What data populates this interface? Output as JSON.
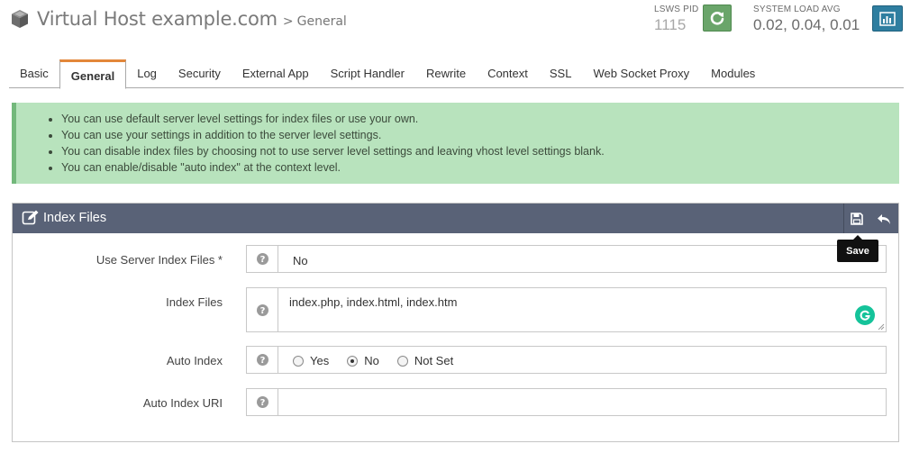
{
  "header": {
    "title": "Virtual Host example.com",
    "separator": ">",
    "subtitle": "General",
    "lsws_pid_label": "LSWS PID",
    "lsws_pid_value": "1115",
    "system_load_label": "SYSTEM LOAD AVG",
    "system_load_value": "0.02, 0.04, 0.01",
    "restart_icon": "refresh-icon",
    "stats_icon": "bar-chart-icon",
    "restart_color": "#6aa56a",
    "stats_color": "#2e7ea0"
  },
  "tabs": [
    {
      "label": "Basic"
    },
    {
      "label": "General"
    },
    {
      "label": "Log"
    },
    {
      "label": "Security"
    },
    {
      "label": "External App"
    },
    {
      "label": "Script Handler"
    },
    {
      "label": "Rewrite"
    },
    {
      "label": "Context"
    },
    {
      "label": "SSL"
    },
    {
      "label": "Web Socket Proxy"
    },
    {
      "label": "Modules"
    }
  ],
  "active_tab": "General",
  "alert": {
    "items": [
      "You can use default server level settings for index files or use your own.",
      "You can use your settings in addition to the server level settings.",
      "You can disable index files by choosing not to use server level settings and leaving vhost level settings blank.",
      "You can enable/disable \"auto index\" at the context level."
    ],
    "color": "#b8e3bd"
  },
  "panel": {
    "title": "Index Files",
    "title_icon": "edit-icon",
    "save_icon": "save-icon",
    "undo_icon": "undo-icon",
    "tooltip": "Save",
    "header_color": "#596277",
    "rows": {
      "use_server": {
        "label": "Use Server Index Files *",
        "value": "No"
      },
      "index_files": {
        "label": "Index Files",
        "value": "index.php, index.html, index.htm"
      },
      "auto_index": {
        "label": "Auto Index",
        "options": [
          "Yes",
          "No",
          "Not Set"
        ],
        "selected": "No"
      },
      "auto_index_uri": {
        "label": "Auto Index URI",
        "value": ""
      }
    }
  }
}
